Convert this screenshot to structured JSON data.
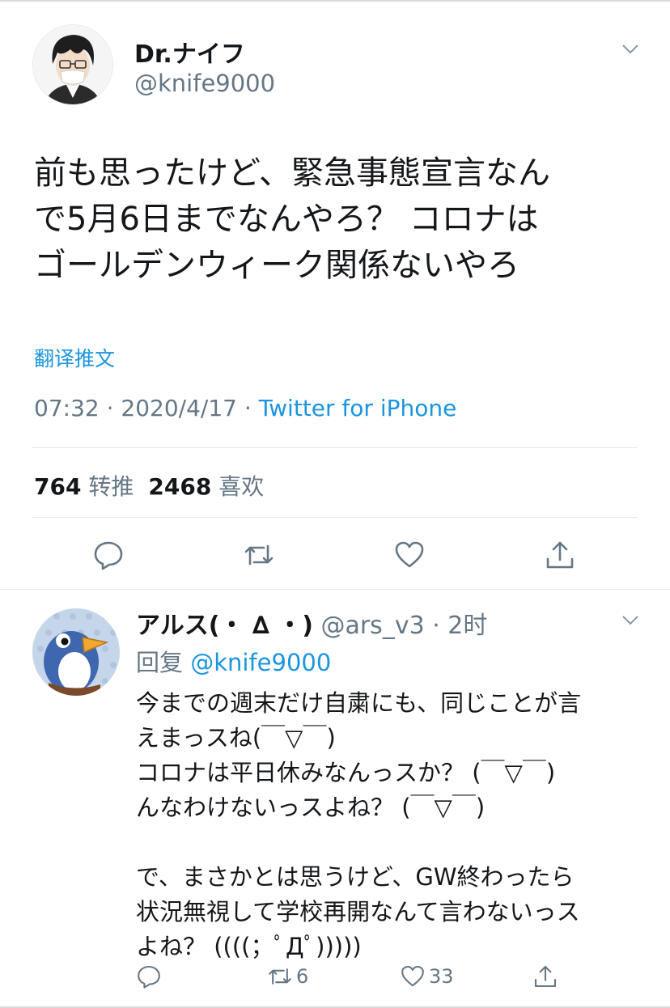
{
  "tweet": {
    "display_name": "Dr.ナイフ",
    "handle": "@knife9000",
    "text_lines": [
      "前も思ったけど、緊急事態宣言なん",
      "で5月6日までなんやろ？ コロナは",
      "ゴールデンウィーク関係ないやろ"
    ],
    "translate_label": "翻译推文",
    "time": "07:32",
    "date": "2020/4/17",
    "source": "Twitter for iPhone",
    "separator": " · ",
    "retweet_count": "764",
    "retweet_label": "转推",
    "like_count": "2468",
    "like_label": "喜欢",
    "actions": [
      "reply-icon",
      "retweet-icon",
      "like-icon",
      "share-icon"
    ]
  },
  "reply": {
    "display_name": "アルス(・ ∆ ・)",
    "handle": "@ars_v3",
    "separator": " · ",
    "time_ago": "2时",
    "reply_prefix": "回复 ",
    "reply_to": "@knife9000",
    "text_lines": [
      "今までの週末だけ自粛にも、同じことが言",
      "えまっスね(￣▽￣)",
      "コロナは平日休みなんっスか？ (￣▽￣)",
      "んなわけないっスよね？ (￣▽￣)",
      "",
      "で、まさかとは思うけど、GW終わったら",
      "状況無視して学校再開なんて言わないっス",
      "よね？ ((((；ﾟДﾟ)))))"
    ],
    "retweet_count": "6",
    "like_count": "33"
  },
  "colors": {
    "link": "#1b95e0",
    "secondary_text": "#657786",
    "divider": "#e1e8ed"
  }
}
